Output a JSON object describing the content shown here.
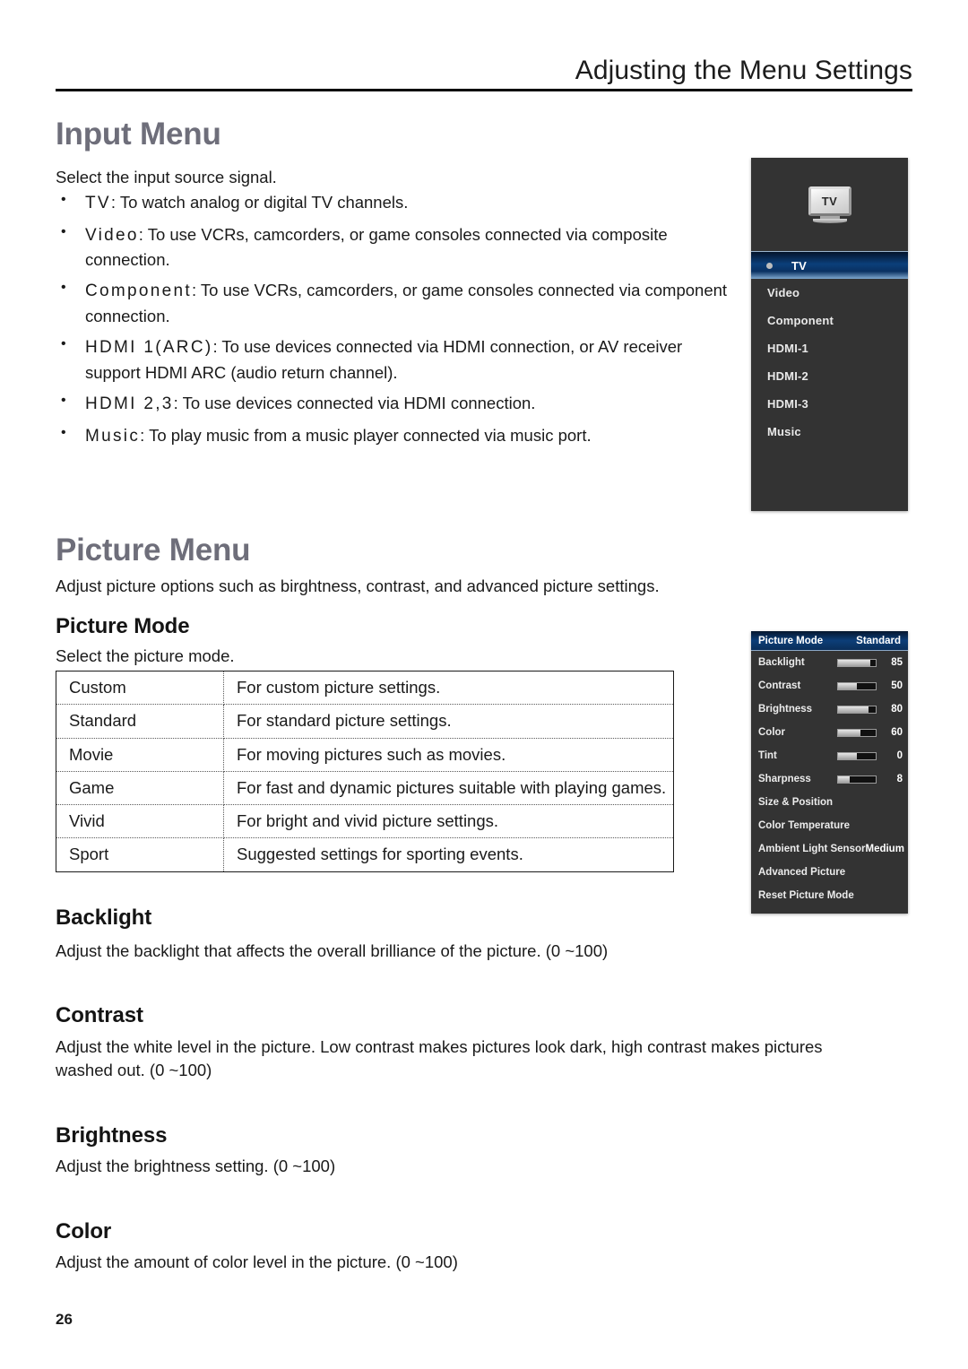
{
  "header": {
    "title": "Adjusting the Menu Settings"
  },
  "page_number": "26",
  "input_menu": {
    "heading": "Input Menu",
    "intro": "Select the input source signal.",
    "bullets": [
      {
        "term": "TV",
        "sep": ":",
        "desc": "To watch analog or digital TV channels."
      },
      {
        "term": "Video",
        "sep": ":",
        "desc": "To use VCRs, camcorders, or game consoles connected via composite connection."
      },
      {
        "term": "Component",
        "sep": ":",
        "desc": "To use VCRs, camcorders, or game consoles connected via component connection."
      },
      {
        "term": "HDMI 1(ARC)",
        "sep": ":",
        "desc": "To use devices connected via HDMI connection, or AV receiver support HDMI ARC (audio return channel)."
      },
      {
        "term": "HDMI 2,3",
        "sep": ":",
        "desc": "To use devices connected via HDMI connection."
      },
      {
        "term": "Music",
        "sep": ":",
        "desc": "To play music from a music player connected via music port."
      }
    ],
    "osd": {
      "icon_label": "TV",
      "icon_name": "tv-monitor-icon",
      "selected": "TV",
      "items": [
        {
          "label": "TV",
          "selected": true
        },
        {
          "label": "Video",
          "selected": false
        },
        {
          "label": "Component",
          "selected": false
        },
        {
          "label": "HDMI-1",
          "selected": false
        },
        {
          "label": "HDMI-2",
          "selected": false
        },
        {
          "label": "HDMI-3",
          "selected": false
        },
        {
          "label": "Music",
          "selected": false
        }
      ],
      "highlight_color": "#0b3f7a",
      "background_color": "#333333"
    }
  },
  "picture_menu": {
    "heading": "Picture Menu",
    "intro": "Adjust picture options such as birghtness, contrast, and advanced picture settings.",
    "picture_mode": {
      "heading": "Picture Mode",
      "intro": "Select the picture mode.",
      "rows": [
        {
          "name": "Custom",
          "description": "For custom picture settings."
        },
        {
          "name": "Standard",
          "description": "For standard picture settings."
        },
        {
          "name": "Movie",
          "description": "For moving pictures such as movies."
        },
        {
          "name": "Game",
          "description": "For fast and dynamic pictures suitable with playing games."
        },
        {
          "name": "Vivid",
          "description": "For bright and vivid picture settings."
        },
        {
          "name": "Sport",
          "description": "Suggested settings for sporting events."
        }
      ]
    },
    "sections": [
      {
        "heading": "Backlight",
        "body": "Adjust the backlight that affects the overall brilliance of the picture. (0 ~100)"
      },
      {
        "heading": "Contrast",
        "body": "Adjust the white level in the picture. Low contrast makes pictures look dark, high contrast makes pictures washed out. (0 ~100)"
      },
      {
        "heading": "Brightness",
        "body": "Adjust the brightness setting. (0 ~100)"
      },
      {
        "heading": "Color",
        "body": "Adjust the amount of color level in the picture. (0 ~100)"
      }
    ],
    "osd": {
      "title_left": "Picture Mode",
      "title_right": "Standard",
      "rows": [
        {
          "label": "Backlight",
          "value": "85",
          "slider": 85,
          "has_slider": true
        },
        {
          "label": "Contrast",
          "value": "50",
          "slider": 50,
          "has_slider": true
        },
        {
          "label": "Brightness",
          "value": "80",
          "slider": 80,
          "has_slider": true
        },
        {
          "label": "Color",
          "value": "60",
          "slider": 60,
          "has_slider": true
        },
        {
          "label": "Tint",
          "value": "0",
          "slider": 50,
          "has_slider": true
        },
        {
          "label": "Sharpness",
          "value": "8",
          "slider": 30,
          "has_slider": true
        },
        {
          "label": "Size & Position",
          "value": "",
          "has_slider": false
        },
        {
          "label": "Color Temperature",
          "value": "",
          "has_slider": false
        },
        {
          "label": "Ambient Light Sensor",
          "value": "Medium",
          "has_slider": false
        },
        {
          "label": "Advanced Picture",
          "value": "",
          "has_slider": false
        },
        {
          "label": "Reset Picture Mode",
          "value": "",
          "has_slider": false
        }
      ],
      "background_color": "#333333",
      "title_color": "#0c3e78"
    }
  }
}
